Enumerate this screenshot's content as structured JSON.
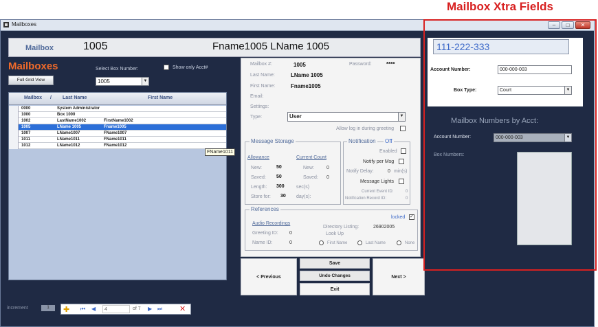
{
  "annotation": {
    "title": "Mailbox Xtra Fields"
  },
  "window": {
    "title": "Mailboxes",
    "min": "–",
    "max": "□",
    "close": "✕"
  },
  "header": {
    "label": "Mailbox",
    "number": "1005",
    "name": "Fname1005 LName 1005"
  },
  "left": {
    "title": "Mailboxes",
    "select_label": "Select Box Number:",
    "show_only_label": "Show only Acct#",
    "full_grid_button": "Full Grid View",
    "box_select_value": "1005",
    "columns": [
      "Mailbox",
      "Last Name",
      "First Name"
    ],
    "sort_glyph": "/",
    "rows": [
      {
        "mailbox": "0000",
        "last": "System Administrator",
        "first": ""
      },
      {
        "mailbox": "1000",
        "last": "Box 1000",
        "first": ""
      },
      {
        "mailbox": "1002",
        "last": "LastName1002",
        "first": "FirstName1002"
      },
      {
        "mailbox": "1005",
        "last": "LName 1005",
        "first": "Fname1005"
      },
      {
        "mailbox": "1007",
        "last": "LName1007",
        "first": "FName1007"
      },
      {
        "mailbox": "1011",
        "last": "LName1011",
        "first": "FName1011"
      },
      {
        "mailbox": "1012",
        "last": "LName1012",
        "first": "FName1012"
      }
    ],
    "selected_index": 3,
    "tooltip": "FName1011"
  },
  "details": {
    "mailbox_label": "Mailbox #:",
    "mailbox_value": "1005",
    "password_label": "Password:",
    "password_value": "****",
    "last_label": "Last Name:",
    "last_value": "LName 1005",
    "first_label": "First Name:",
    "first_value": "Fname1005",
    "email_label": "Email:",
    "settings_label": "Settings:",
    "type_label": "Type:",
    "type_value": "User",
    "allow_login_label": "Allow log in during greeting"
  },
  "storage": {
    "title": "Message Storage",
    "allowance_link": "Allowance",
    "current_link": "Current Count",
    "new_label": "New:",
    "new_allow": "50",
    "new_count": "0",
    "saved_label": "Saved:",
    "saved_allow": "50",
    "saved_count": "0",
    "length_label": "Length:",
    "length_value": "300",
    "length_unit": "sec(s)",
    "store_label": "Store for:",
    "store_value": "30",
    "store_unit": "day(s):"
  },
  "notification": {
    "title": "Notification",
    "state": "Off",
    "enabled_label": "Enabled",
    "notify_label": "Notify per Msg",
    "delay_label": "Notify Delay:",
    "delay_value": "0",
    "delay_unit": "min(s)",
    "lights_label": "Message Lights",
    "event_label": "Current Event ID:",
    "event_value": "0",
    "record_label": "Notification Record ID:",
    "record_value": "0"
  },
  "references": {
    "title": "References",
    "locked_label": "locked",
    "audio_link": "Audio Recordings",
    "greeting_label": "Greeting ID:",
    "greeting_value": "0",
    "name_label": "Name ID:",
    "name_value": "0",
    "dir_label": "Directory Listing:",
    "dir_value": "26902005",
    "lookup_label": "Look Up",
    "radio_first": "First Name",
    "radio_last": "Last Name",
    "radio_none": "None"
  },
  "actions": {
    "previous": "< Previous",
    "save": "Save",
    "undo": "Undo Changes",
    "exit": "Exit",
    "next": "Next >"
  },
  "xtra": {
    "phone": "111-222-333",
    "account_label": "Account Number:",
    "account_value": "000-000-003",
    "box_type_label": "Box Type:",
    "box_type_value": "Court",
    "numbers_title": "Mailbox  Numbers by Acct:",
    "acct_label2": "Account Number:",
    "acct_value2": "000-000-003",
    "box_numbers_label": "Box Numbers:"
  },
  "footer": {
    "increment_label": "increment",
    "increment_value": "1",
    "page_value": "4",
    "page_of": "of 7"
  }
}
